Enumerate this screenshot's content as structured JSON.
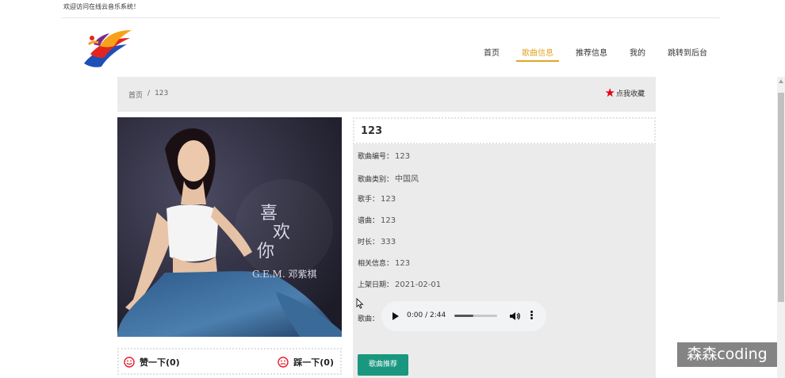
{
  "topbar": {
    "welcome": "欢迎访问在线云音乐系统！"
  },
  "nav": {
    "items": [
      {
        "label": "首页"
      },
      {
        "label": "歌曲信息",
        "active": true
      },
      {
        "label": "推荐信息"
      },
      {
        "label": "我的"
      },
      {
        "label": "跳转到后台"
      }
    ]
  },
  "breadcrumb": {
    "home": "首页",
    "separator": "/",
    "current": "123"
  },
  "favorite": {
    "label": "点我收藏",
    "icon": "star-icon",
    "color": "#e60012"
  },
  "cover": {
    "title_line1": "喜",
    "title_line2": "欢",
    "title_line3": "你",
    "artist": "G.E.M. 邓紫棋"
  },
  "vote": {
    "like_label": "赞一下(0)",
    "dislike_label": "踩一下(0)",
    "icon_color": "#e8192c"
  },
  "song": {
    "title": "123",
    "fields": [
      {
        "label": "歌曲编号：",
        "value": "123"
      },
      {
        "label": "歌曲类别：",
        "value": "中国风"
      },
      {
        "label": "歌手：",
        "value": "123"
      },
      {
        "label": "谱曲：",
        "value": "123"
      },
      {
        "label": "时长：",
        "value": "333"
      },
      {
        "label": "相关信息：",
        "value": "123"
      },
      {
        "label": "上架日期：",
        "value": "2021-02-01"
      }
    ],
    "audio_label": "歌曲：",
    "audio_time": "0:00 / 2:44",
    "audio_progress_fraction": 0.45
  },
  "actions": {
    "recommend_label": "歌曲推荐",
    "recommend_color": "#19977f"
  },
  "watermark": {
    "text": "森森coding"
  },
  "colors": {
    "accent": "#e0a526",
    "panel": "#ebebeb"
  }
}
